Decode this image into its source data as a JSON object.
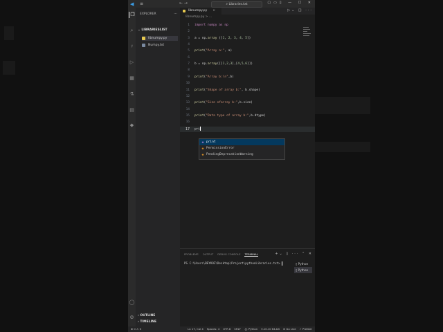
{
  "window": {
    "search_text": "Libraries.txt",
    "menu": "≡"
  },
  "sidebar": {
    "header": "EXPLORER",
    "folder": "LIBRARIESLIST",
    "files": [
      {
        "name": "libnumpy.py",
        "color": "#e6c84e"
      },
      {
        "name": "Numpy.txt",
        "color": "#7a8aa0"
      }
    ],
    "outline": "OUTLINE",
    "timeline": "TIMELINE"
  },
  "editor": {
    "tab_label": "libnumpy.py",
    "tab_close": "×",
    "breadcrumb": "libnumpy.py > ..."
  },
  "code": [
    {
      "n": "1",
      "text": "import numpy as np"
    },
    {
      "n": "2",
      "text": ""
    },
    {
      "n": "3",
      "text": "a = np.array ([1, 2, 3, 4, 5])"
    },
    {
      "n": "4",
      "text": ""
    },
    {
      "n": "5",
      "text": "print(\"Array a:\", a)"
    },
    {
      "n": "6",
      "text": ""
    },
    {
      "n": "7",
      "text": "b = np.array([[1,2,3],[4,5,6]])"
    },
    {
      "n": "8",
      "text": ""
    },
    {
      "n": "9",
      "text": "print(\"Array b:\\n\",b)"
    },
    {
      "n": "10",
      "text": ""
    },
    {
      "n": "11",
      "text": "print(\"Shape of array b:\", b.shape)"
    },
    {
      "n": "12",
      "text": ""
    },
    {
      "n": "13",
      "text": "print(\"Size ofarray b:\",b.size)"
    },
    {
      "n": "14",
      "text": ""
    },
    {
      "n": "15",
      "text": "print(\"Data type of array b:\",b.dtype)"
    },
    {
      "n": "16",
      "text": ""
    },
    {
      "n": "17",
      "text": "pri"
    }
  ],
  "suggestions": [
    "print",
    "PermissionError",
    "PendingDeprecationWarning"
  ],
  "panel": {
    "tabs": [
      "PROBLEMS",
      "OUTPUT",
      "DEBUG CONSOLE",
      "TERMINAL"
    ],
    "active_tab": "TERMINAL",
    "terminal_line": "PS C:\\Users\\BEYKOZ\\Desktop\\Project\\pythonLibraries.txt>",
    "terminals": [
      "Python",
      "Python"
    ]
  },
  "statusbar": {
    "left": "⊗ 0 ⚠ 0",
    "items": [
      "Ln 17, Col 4",
      "Spaces: 4",
      "UTF-8",
      "CRLF",
      "{} Python",
      "3.10.10 64-bit",
      "⊘ Go Live",
      "✓ Prettier"
    ]
  }
}
